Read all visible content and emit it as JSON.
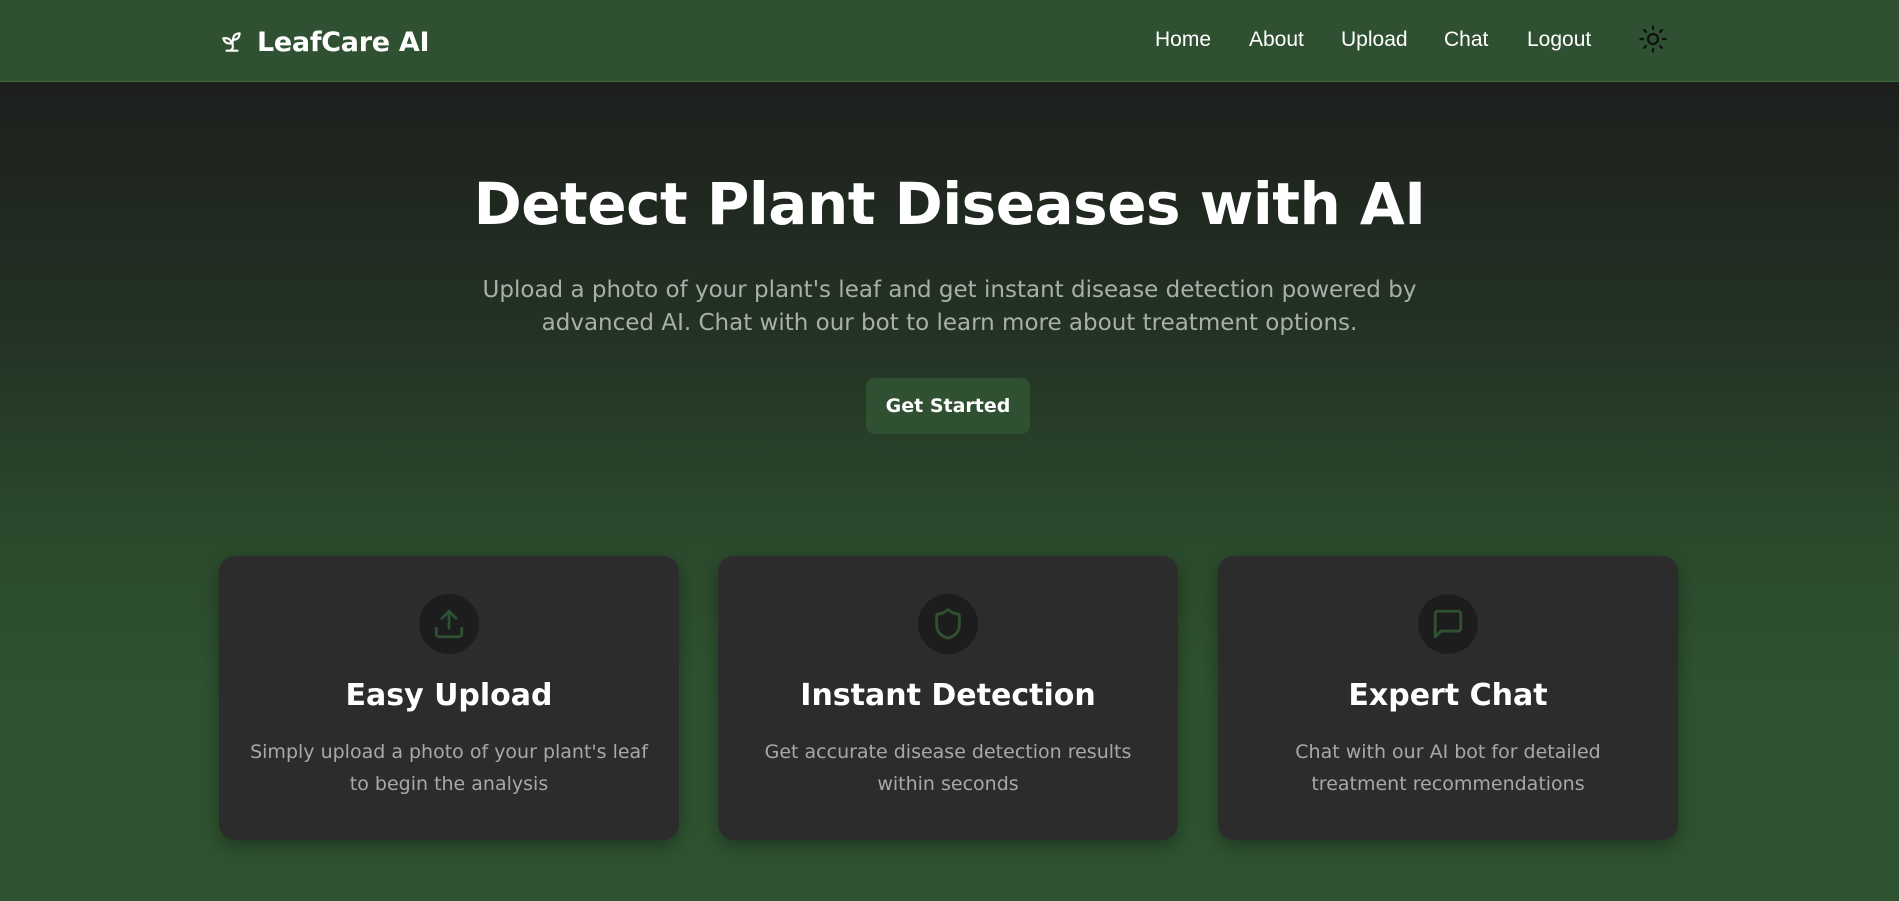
{
  "nav": {
    "brand": "LeafCare AI",
    "brand_icon": "sprout-icon",
    "links": [
      {
        "label": "Home"
      },
      {
        "label": "About"
      },
      {
        "label": "Upload"
      },
      {
        "label": "Chat"
      },
      {
        "label": "Logout"
      }
    ],
    "theme_icon": "sun-icon"
  },
  "hero": {
    "title": "Detect Plant Diseases with AI",
    "subtitle": "Upload a photo of your plant's leaf and get instant disease detection powered by advanced AI. Chat with our bot to learn more about treatment options.",
    "cta_label": "Get Started"
  },
  "features": [
    {
      "icon": "upload-icon",
      "title": "Easy Upload",
      "description": "Simply upload a photo of your plant's leaf to begin the analysis"
    },
    {
      "icon": "shield-icon",
      "title": "Instant Detection",
      "description": "Get accurate disease detection results within seconds"
    },
    {
      "icon": "message-square-icon",
      "title": "Expert Chat",
      "description": "Chat with our AI bot for detailed treatment recommendations"
    }
  ],
  "colors": {
    "accent": "#2f5131",
    "icon_green": "#2f5131",
    "card_bg": "#2c2c2c"
  }
}
